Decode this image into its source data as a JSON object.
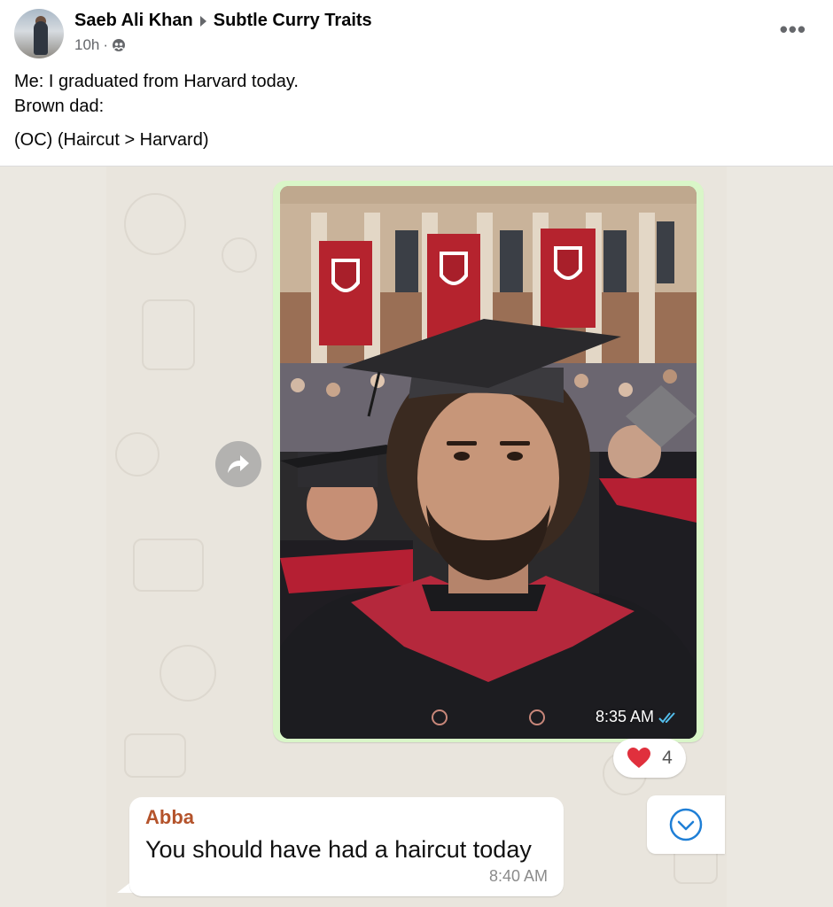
{
  "post": {
    "author": "Saeb Ali Khan",
    "group": "Subtle Curry Traits",
    "time": "10h",
    "separator": "·",
    "privacy_icon": "group-icon",
    "more_icon": "more-options-icon",
    "text_line1": "Me: I graduated from Harvard today.",
    "text_line2": "Brown dad:",
    "text_line3": "(OC) (Haircut > Harvard)"
  },
  "chat": {
    "photo_message": {
      "time": "8:35 AM",
      "status_icon": "double-check-icon",
      "image_description_icon": "graduation-selfie"
    },
    "reaction": {
      "emoji": "❤️",
      "count": "4"
    },
    "incoming_message": {
      "sender": "Abba",
      "text": "You should have had a haircut today",
      "time": "8:40 AM"
    },
    "forward_icon": "forward-arrow-icon",
    "scroll_icon": "chevron-down-circle-icon"
  },
  "colors": {
    "sender_name": "#b4532b",
    "outgoing_bubble": "#d9f6c8",
    "chat_background": "#e9e5dd",
    "tick_blue": "#53bdeb"
  }
}
